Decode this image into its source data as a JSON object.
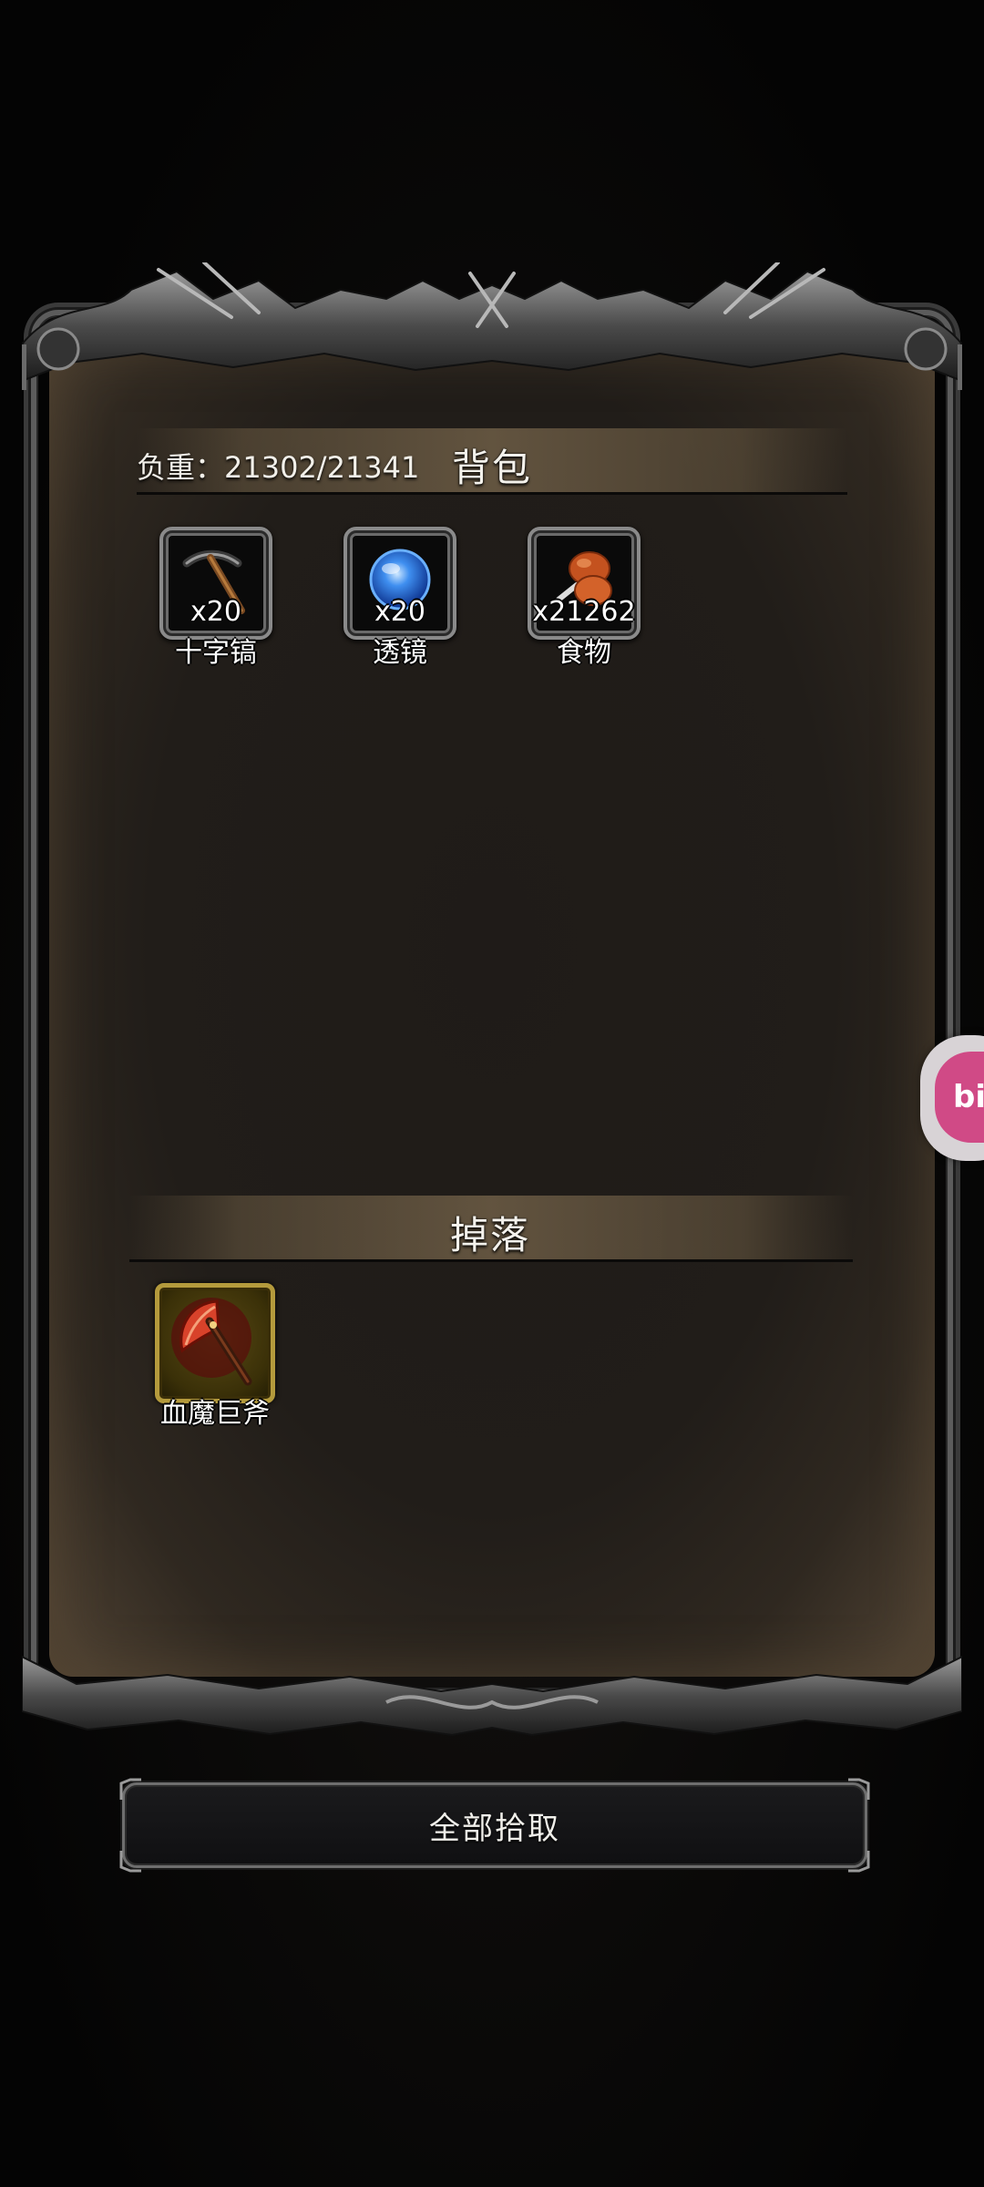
{
  "inventory": {
    "weight_label": "负重：21302/21341",
    "title": "背包",
    "items": [
      {
        "icon": "pickaxe-icon",
        "count": "x20",
        "name": "十字镐"
      },
      {
        "icon": "lens-icon",
        "count": "x20",
        "name": "透镜"
      },
      {
        "icon": "food-icon",
        "count": "x21262",
        "name": "食物"
      }
    ]
  },
  "drops": {
    "title": "掉落",
    "items": [
      {
        "icon": "axe-icon",
        "name": "血魔巨斧"
      }
    ]
  },
  "actions": {
    "pickup_all_label": "全部拾取"
  },
  "overlay": {
    "bili_label": "bili"
  },
  "colors": {
    "panel_bg": "#211d19",
    "header_band": "#786650",
    "drop_frame": "#b49a3c",
    "bili_pink": "#d04a86"
  }
}
